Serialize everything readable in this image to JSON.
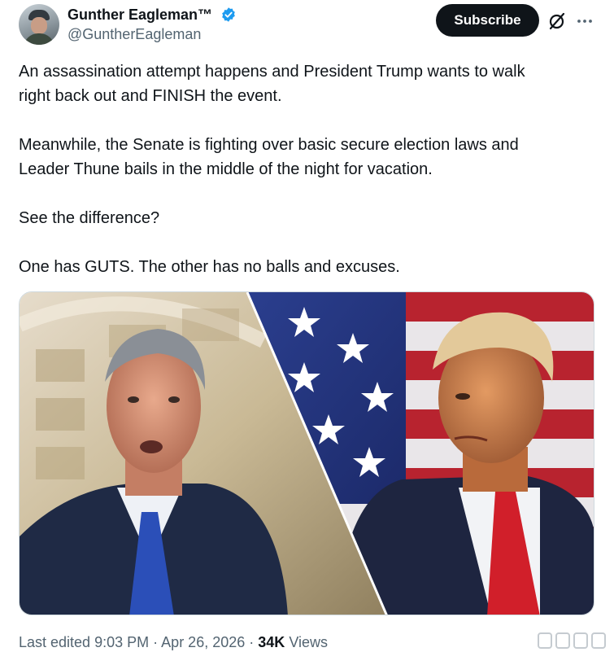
{
  "author": {
    "display_name": "Gunther Eagleman™",
    "handle": "@GuntherEagleman",
    "verified": true
  },
  "actions": {
    "subscribe_label": "Subscribe",
    "grok_icon": "grok-icon",
    "more_icon": "more-horizontal-icon"
  },
  "tweet": {
    "paragraphs": [
      "An assassination attempt happens and President Trump wants to walk",
      "right back out and FINISH the event.",
      "Meanwhile, the Senate is fighting over basic secure election laws and",
      "Leader Thune bails in the middle of the night for vacation.",
      "See the difference?",
      "One has GUTS. The other has no balls and excuses."
    ]
  },
  "meta": {
    "edited_label": "Last edited",
    "time": "9:03 PM",
    "separator": "·",
    "date": "Apr 26, 2026",
    "views_count": "34K",
    "views_label": "Views"
  },
  "colors": {
    "text_primary": "#0f1419",
    "text_secondary": "#536471",
    "verified_blue": "#1d9bf0",
    "button_dark": "#0f1419"
  }
}
